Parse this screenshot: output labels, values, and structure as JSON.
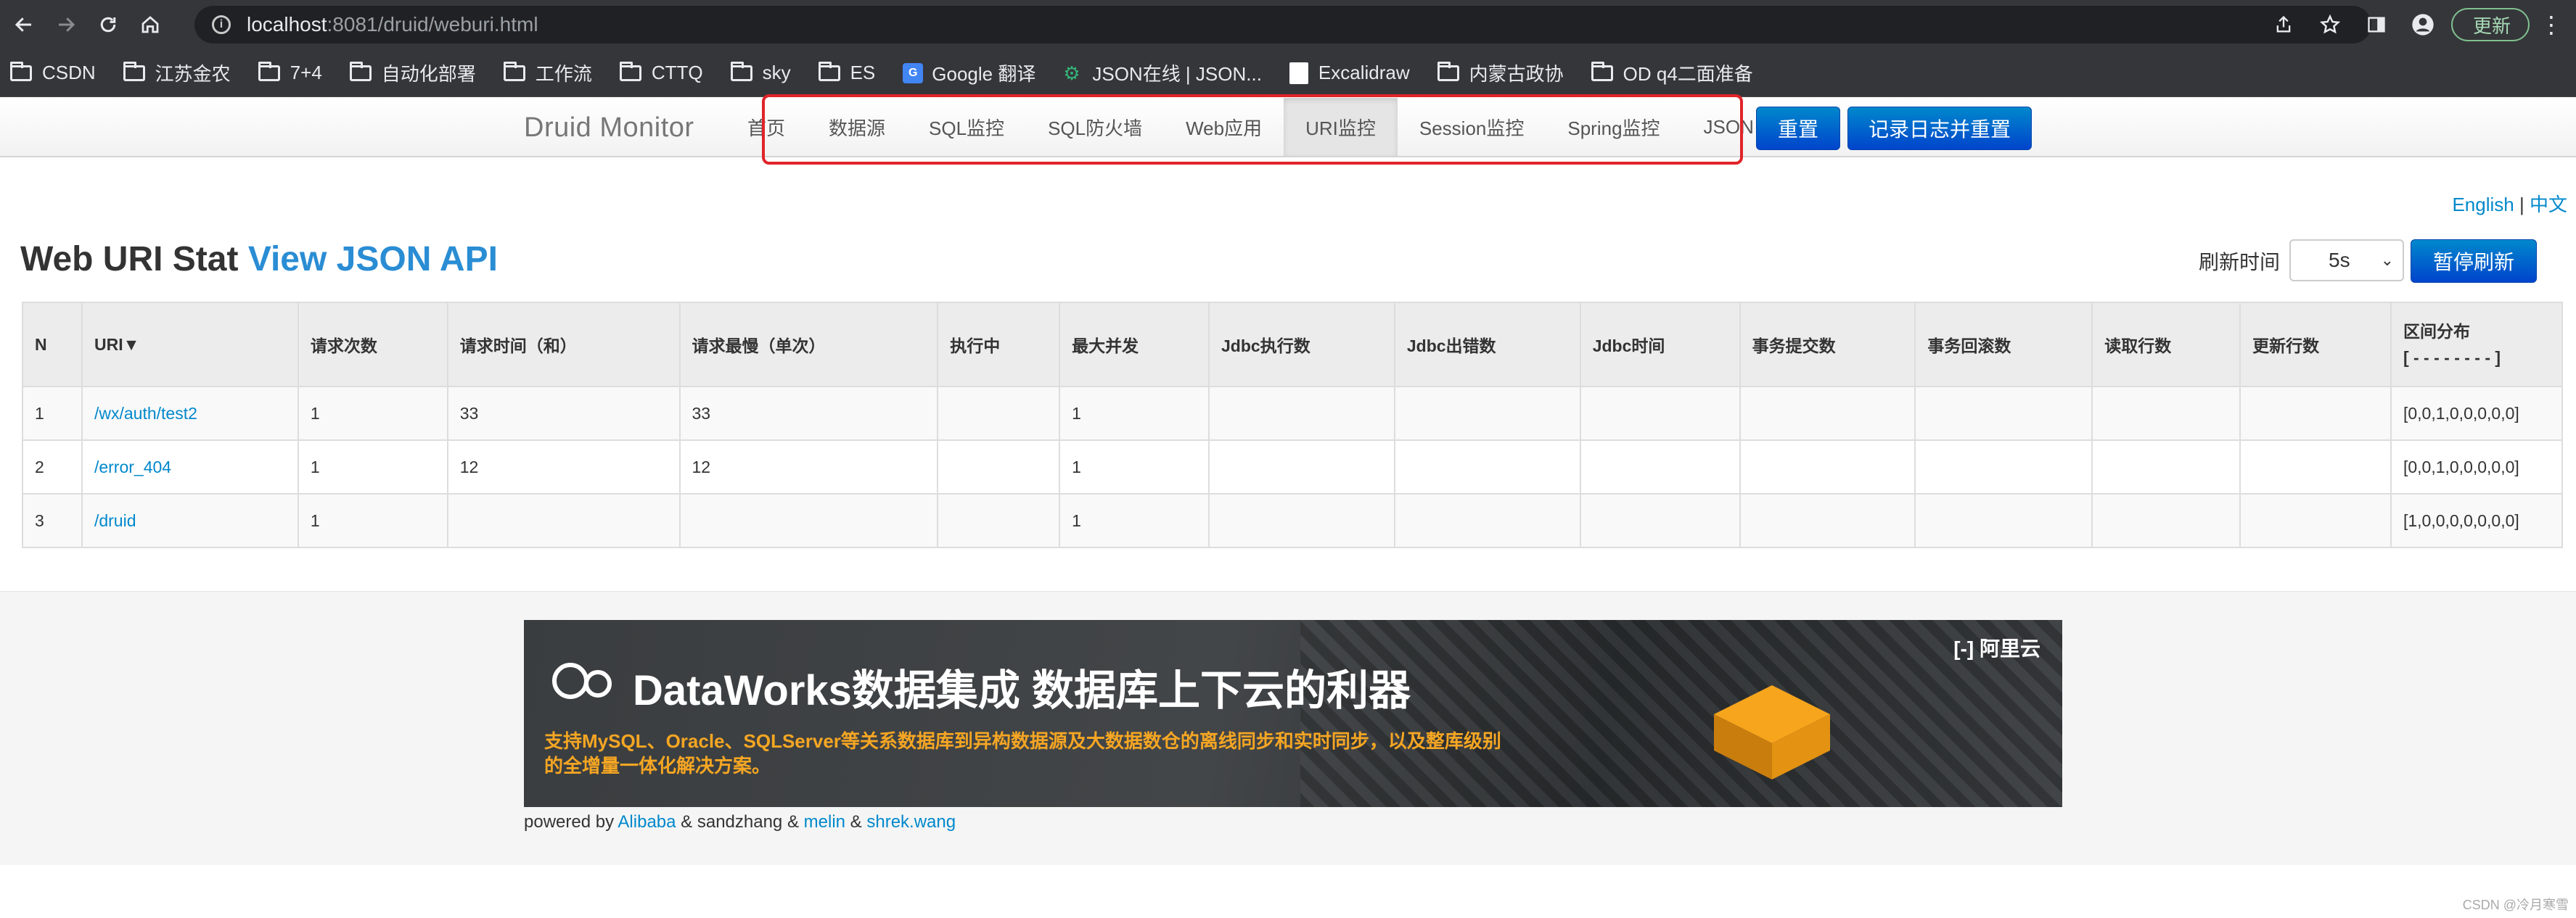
{
  "browser": {
    "url_host": "localhost",
    "url_path": ":8081/druid/weburi.html",
    "update_label": "更新",
    "bookmarks": [
      "CSDN",
      "江苏金农",
      "7+4",
      "自动化部署",
      "工作流",
      "CTTQ",
      "sky",
      "ES",
      "Google 翻译",
      "JSON在线 | JSON...",
      "Excalidraw",
      "内蒙古政协",
      "OD q4二面准备"
    ]
  },
  "navbar": {
    "brand": "Druid Monitor",
    "items": [
      "首页",
      "数据源",
      "SQL监控",
      "SQL防火墙",
      "Web应用",
      "URI监控",
      "Session监控",
      "Spring监控",
      "JSON API"
    ],
    "active_index": 5,
    "reset_label": "重置",
    "log_reset_label": "记录日志并重置",
    "highlight_color": "#e0242a"
  },
  "lang": {
    "english": "English",
    "separator": "|",
    "chinese": "中文"
  },
  "page": {
    "title": "Web URI Stat",
    "title_link": "View JSON API",
    "refresh_label": "刷新时间",
    "refresh_value": "5s",
    "pause_label": "暂停刷新"
  },
  "table": {
    "columns": [
      "N",
      "URI▼",
      "请求次数",
      "请求时间（和）",
      "请求最慢（单次）",
      "执行中",
      "最大并发",
      "Jdbc执行数",
      "Jdbc出错数",
      "Jdbc时间",
      "事务提交数",
      "事务回滚数",
      "读取行数",
      "更新行数",
      "区间分布"
    ],
    "dist_sub": "[ - - - - - - - - ]",
    "rows": [
      [
        "1",
        "/wx/auth/test2",
        "1",
        "33",
        "33",
        "",
        "1",
        "",
        "",
        "",
        "",
        "",
        "",
        "",
        "[0,0,1,0,0,0,0,0]"
      ],
      [
        "2",
        "/error_404",
        "1",
        "12",
        "12",
        "",
        "1",
        "",
        "",
        "",
        "",
        "",
        "",
        "",
        "[0,0,1,0,0,0,0,0]"
      ],
      [
        "3",
        "/druid",
        "1",
        "",
        "",
        "",
        "1",
        "",
        "",
        "",
        "",
        "",
        "",
        "",
        "[1,0,0,0,0,0,0,0]"
      ]
    ]
  },
  "banner": {
    "title": "DataWorks数据集成 数据库上下云的利器",
    "subtitle": "支持MySQL、Oracle、SQLServer等关系数据库到异构数据源及大数据数仓的离线同步和实时同步，以及整库级别的全增量一体化解决方案。",
    "vendor": "阿里云"
  },
  "footer": {
    "prefix": "powered by",
    "alibaba": "Alibaba",
    "amp1": "&",
    "sandzhang": "sandzhang",
    "amp2": "&",
    "melin": "melin",
    "amp3": "&",
    "shrek": "shrek.wang"
  },
  "watermark": "CSDN @冷月寒雪"
}
